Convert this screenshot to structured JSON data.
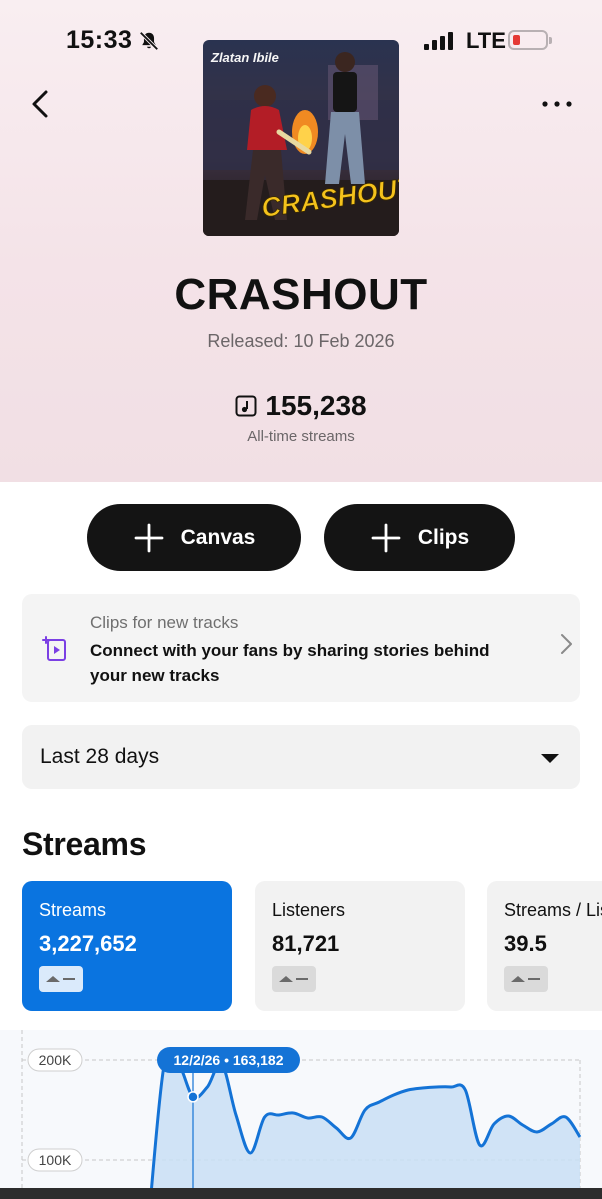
{
  "status_bar": {
    "time": "15:33",
    "network": "LTE"
  },
  "header": {
    "title": "CRASHOUT",
    "released": "Released: 10 Feb 2026",
    "total_streams": "155,238",
    "total_streams_label": "All-time streams",
    "cover_text": {
      "artist": "Zlatan Ibile",
      "title": "CRASHOUT!"
    }
  },
  "actions": {
    "canvas_label": "Canvas",
    "clips_label": "Clips"
  },
  "promo": {
    "title": "Clips for new tracks",
    "body": "Connect with your fans by sharing stories behind your new tracks"
  },
  "date_range": {
    "selected": "Last 28 days"
  },
  "section": {
    "title": "Streams"
  },
  "metrics": [
    {
      "label": "Streams",
      "value": "3,227,652",
      "active": true
    },
    {
      "label": "Listeners",
      "value": "81,721",
      "active": false
    },
    {
      "label": "Streams / Listener",
      "value": "39.5",
      "active": false
    }
  ],
  "chart_data": {
    "type": "area",
    "y_ticks": [
      "200K",
      "100K"
    ],
    "tooltip": {
      "date": "12/2/26",
      "value": "163,182"
    },
    "series": [
      {
        "values": [
          0,
          196000,
          196000,
          163182,
          173000,
          196000,
          145000,
          107000,
          143000,
          145000,
          147000,
          142000,
          143000,
          132000,
          122000,
          150000,
          158000,
          165000,
          170000,
          172000,
          173000,
          173000,
          170000,
          115000,
          136000,
          144000,
          135000,
          128000,
          136000,
          143000,
          123000
        ]
      }
    ],
    "ylim": [
      0,
      220000
    ],
    "colors": {
      "line": "#1473d6",
      "fill": "#c9dff5",
      "tooltip": "#1473d6"
    }
  }
}
